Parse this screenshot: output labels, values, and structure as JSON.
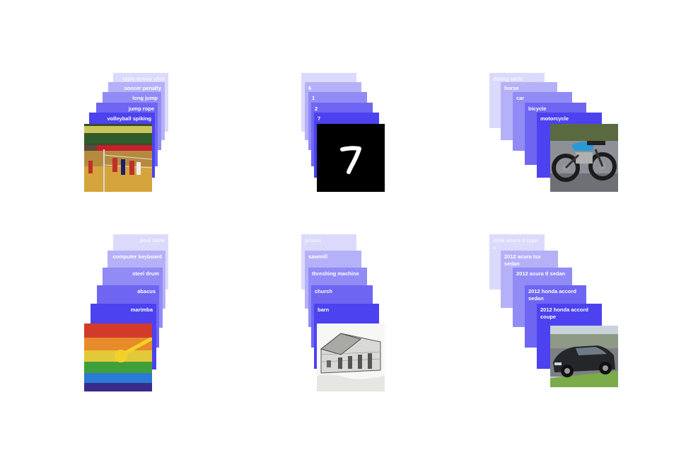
{
  "groups": [
    {
      "labels": [
        "table tennis shot",
        "soccer penalty",
        "long jump",
        "jump rope",
        "volleyball spiking"
      ],
      "image": "volleyball-photo"
    },
    {
      "labels": [
        "",
        "6",
        "1",
        "2",
        "7"
      ],
      "image": "handwritten-digit-seven"
    },
    {
      "labels": [
        "dining table",
        "horse",
        "car",
        "bicycle",
        "motorcycle"
      ],
      "image": "motorcycle-photo"
    },
    {
      "labels": [
        "pool table",
        "computer keyboard",
        "steel drum",
        "abacus",
        "marimba"
      ],
      "image": "marimba-photo"
    },
    {
      "labels": [
        "prison",
        "sawmill",
        "threshing machine",
        "church",
        "barn"
      ],
      "image": "barn-sketch"
    },
    {
      "labels": [
        "2006 acura tl type-s",
        "2012 acura tsx sedan",
        "2012 acura tl sedan",
        "2012 honda accord sedan",
        "2012 honda accord coupe"
      ],
      "image": "honda-accord-photo"
    }
  ]
}
